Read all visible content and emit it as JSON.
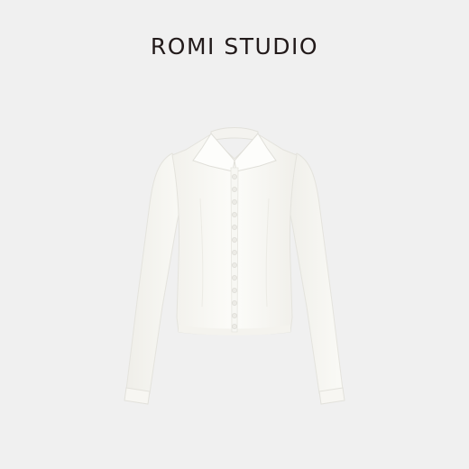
{
  "brand": {
    "name": "ROMI STUDIO"
  },
  "product_image": {
    "subject": "white-collared-long-sleeve-shirt",
    "garment_color": "#fbfbf7",
    "background_color": "#f0f0f0",
    "button_count": 13
  }
}
